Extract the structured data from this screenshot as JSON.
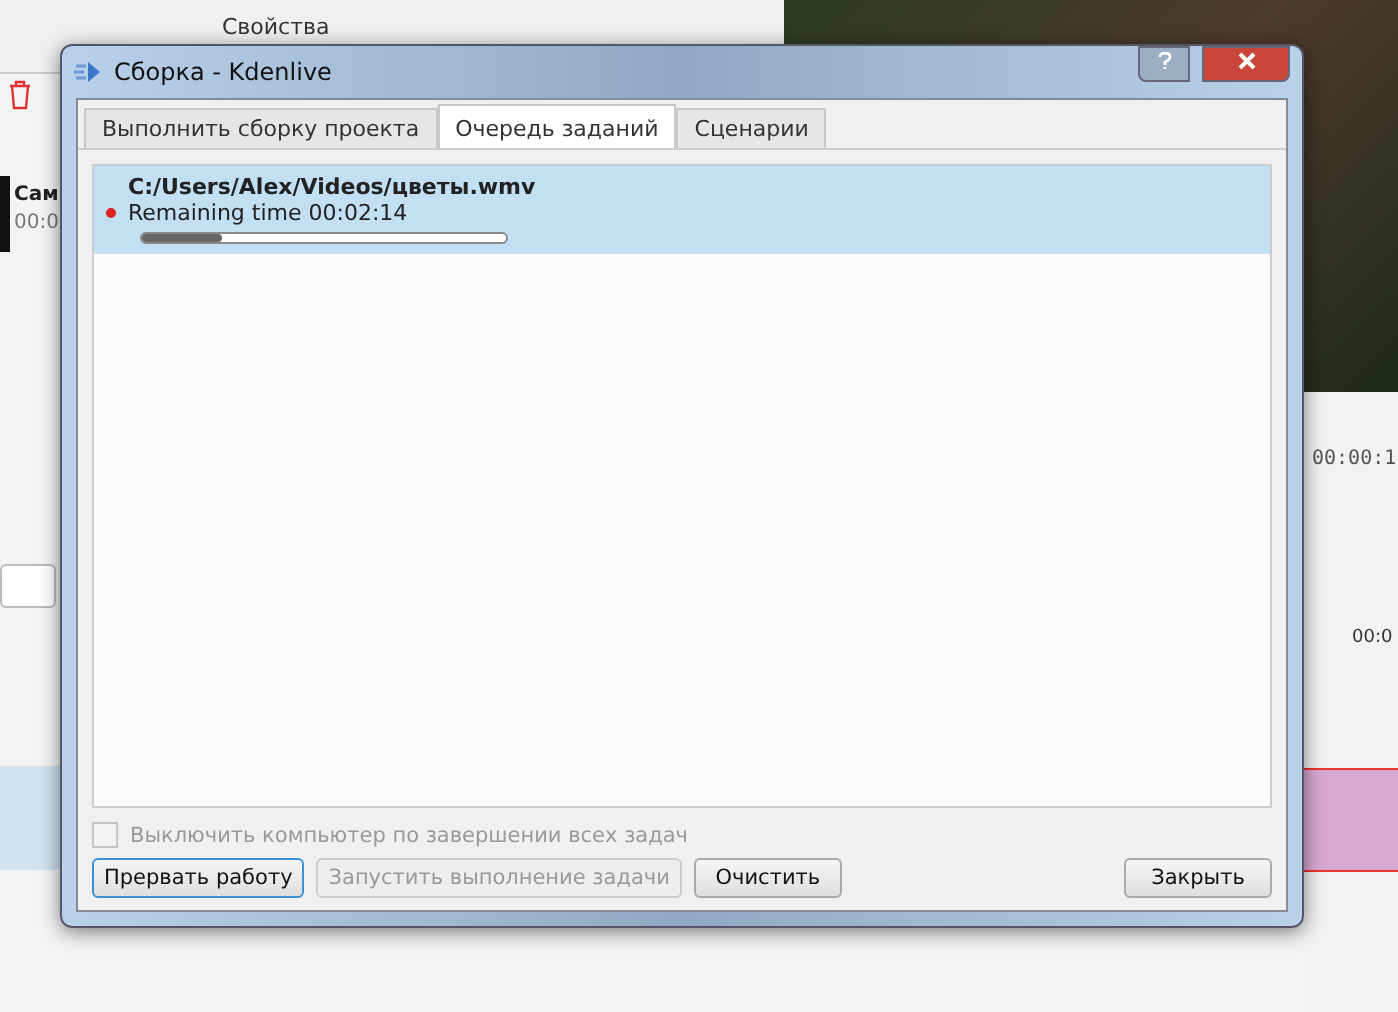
{
  "background_app": {
    "panel_title": "Свойства",
    "clip_name": "Сам",
    "clip_time": "00:0",
    "monitor_timecode": "00:00:1",
    "ruler_timecode": "00:0"
  },
  "window": {
    "title": "Сборка - Kdenlive"
  },
  "tabs": [
    {
      "label": "Выполнить сборку проекта",
      "selected": false
    },
    {
      "label": "Очередь заданий",
      "selected": true
    },
    {
      "label": "Сценарии",
      "selected": false
    }
  ],
  "jobs": [
    {
      "path": "C:/Users/Alex/Videos/цветы.wmv",
      "status": "Remaining time 00:02:14",
      "level": 0.22,
      "selected": true
    }
  ],
  "shutdown_option": {
    "label": "Выключить компьютер по завершении всех задач",
    "checked": false,
    "disabled": true
  },
  "buttons": [
    {
      "label": "Прервать работу",
      "disabled": false,
      "focused": true
    },
    {
      "label": "Запустить выполнение задачи",
      "disabled": true,
      "focused": false
    },
    {
      "label": "Очистить",
      "disabled": false,
      "focused": false
    },
    {
      "label": "Закрыть",
      "disabled": false,
      "focused": false
    }
  ]
}
